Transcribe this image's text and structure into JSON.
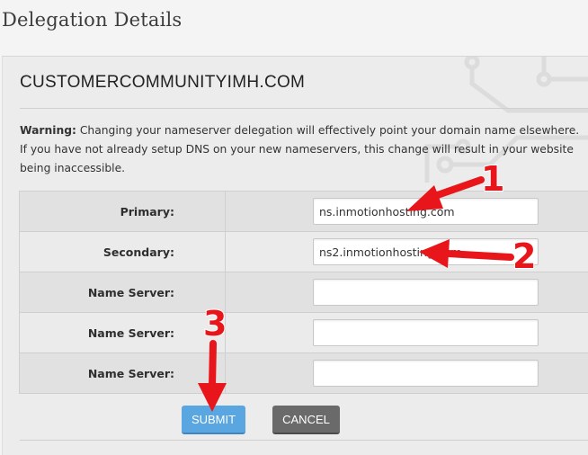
{
  "page_title": "Delegation Details",
  "domain": "CUSTOMERCOMMUNITYIMH.COM",
  "warning": {
    "label": "Warning:",
    "text": " Changing your nameserver delegation will effectively point your domain name elsewhere. If you have not already setup DNS on your new nameservers, this change will result in your website being inaccessible."
  },
  "nameservers": [
    {
      "label": "Primary:",
      "value": "ns.inmotionhosting.com"
    },
    {
      "label": "Secondary:",
      "value": "ns2.inmotionhosting.com"
    },
    {
      "label": "Name Server:",
      "value": ""
    },
    {
      "label": "Name Server:",
      "value": ""
    },
    {
      "label": "Name Server:",
      "value": ""
    }
  ],
  "buttons": {
    "submit": "SUBMIT",
    "cancel": "CANCEL"
  },
  "annotations": {
    "one": "1",
    "two": "2",
    "three": "3",
    "arrow_color": "#e8161b"
  }
}
